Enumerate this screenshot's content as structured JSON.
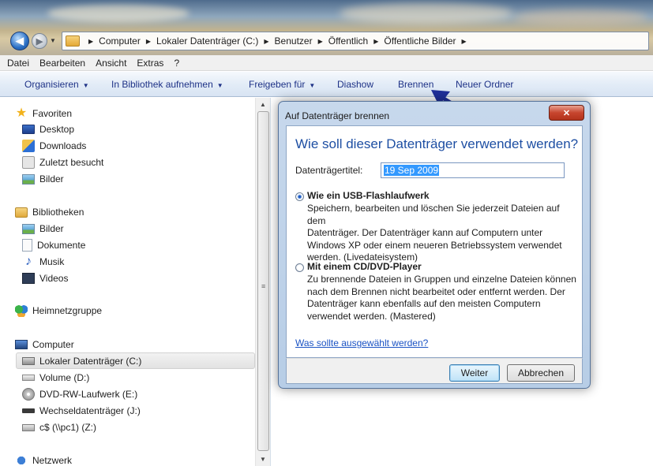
{
  "address": {
    "crumbs": [
      "Computer",
      "Lokaler Datenträger (C:)",
      "Benutzer",
      "Öffentlich",
      "Öffentliche Bilder"
    ]
  },
  "menu": [
    "Datei",
    "Bearbeiten",
    "Ansicht",
    "Extras",
    "?"
  ],
  "toolbar": {
    "organize": "Organisieren",
    "library": "In Bibliothek aufnehmen",
    "share": "Freigeben für",
    "slideshow": "Diashow",
    "burn": "Brennen",
    "new_folder": "Neuer Ordner"
  },
  "nav": {
    "favorites": "Favoriten",
    "desktop": "Desktop",
    "downloads": "Downloads",
    "recent": "Zuletzt besucht",
    "fav_pictures": "Bilder",
    "libraries": "Bibliotheken",
    "lib_pictures": "Bilder",
    "documents": "Dokumente",
    "music": "Musik",
    "videos": "Videos",
    "homegroup": "Heimnetzgruppe",
    "computer": "Computer",
    "drive_c": "Lokaler Datenträger (C:)",
    "drive_d": "Volume (D:)",
    "drive_e": "DVD-RW-Laufwerk (E:)",
    "drive_j": "Wechseldatenträger (J:)",
    "drive_z": "c$ (\\\\pc1) (Z:)",
    "network": "Netzwerk"
  },
  "dialog": {
    "title": "Auf Datenträger brennen",
    "heading": "Wie soll dieser Datenträger verwendet werden?",
    "disc_title_label": "Datenträgertitel:",
    "disc_title_value": "19 Sep 2009",
    "option1": {
      "label": "Wie ein USB-Flashlaufwerk",
      "line1": "Speichern, bearbeiten und löschen Sie jederzeit Dateien auf dem",
      "line2": "Datenträger. Der Datenträger kann auf Computern unter",
      "line3": "Windows XP oder einem neueren Betriebssystem verwendet",
      "line4": "werden. (Livedateisystem)",
      "selected": true
    },
    "option2": {
      "label": "Mit einem CD/DVD-Player",
      "line1": "Zu brennende Dateien in Gruppen und einzelne Dateien können",
      "line2": "nach dem Brennen nicht bearbeitet oder entfernt werden. Der",
      "line3": "Datenträger kann ebenfalls auf den meisten Computern",
      "line4": "verwendet werden. (Mastered)",
      "selected": false
    },
    "help_link": "Was sollte ausgewählt werden?",
    "next_button": "Weiter",
    "cancel_button": "Abbrechen"
  },
  "colors": {
    "heading": "#1e4fa3",
    "link": "#1b53c4",
    "arrow": "#1f2f9a"
  }
}
